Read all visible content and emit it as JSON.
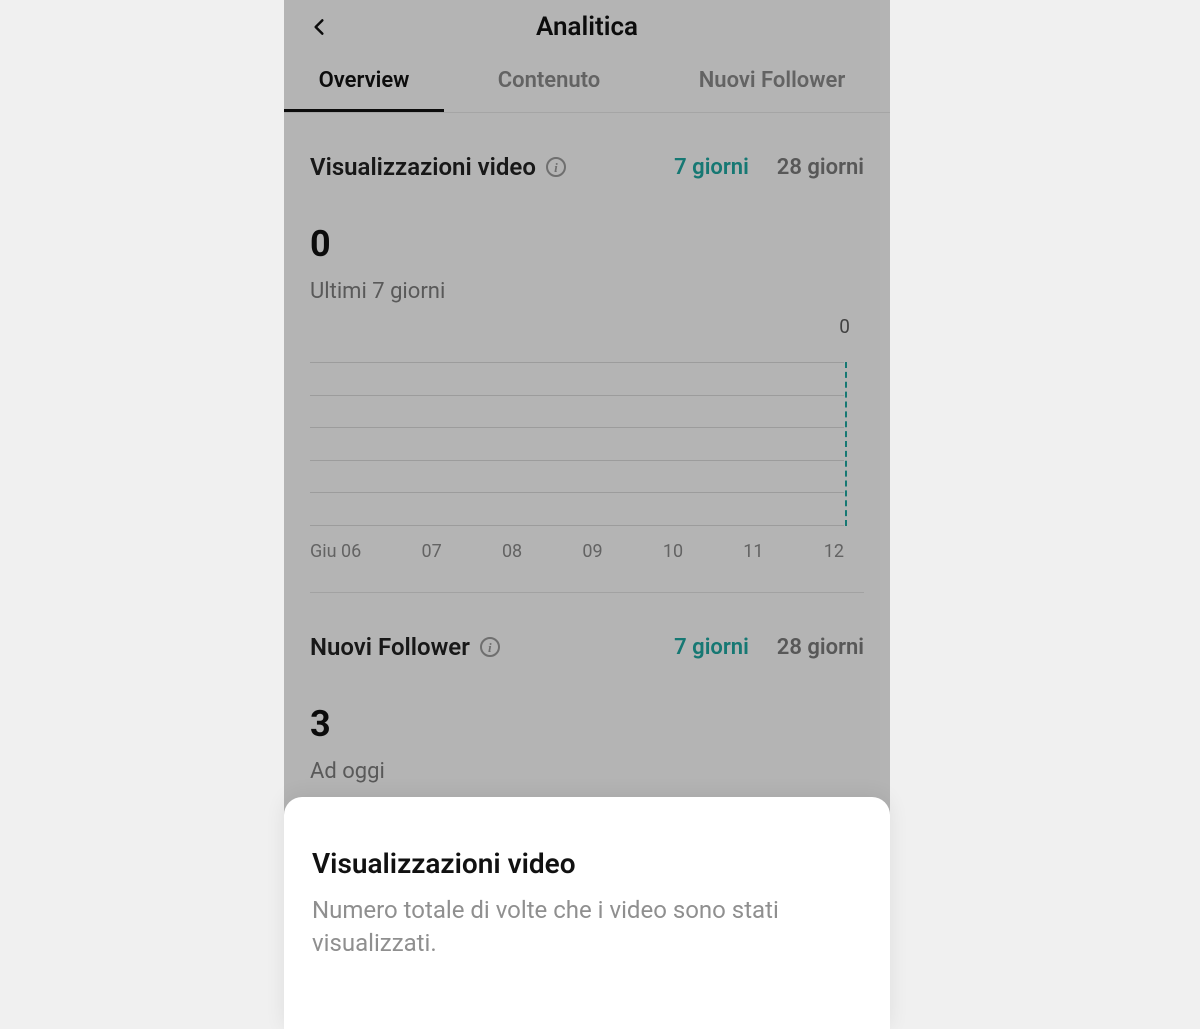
{
  "header": {
    "title": "Analitica"
  },
  "tabs": [
    {
      "label": "Overview",
      "active": true
    },
    {
      "label": "Contenuto",
      "active": false
    },
    {
      "label": "Nuovi Follower",
      "active": false
    }
  ],
  "video_views": {
    "title": "Visualizzazioni video",
    "range_7": "7 giorni",
    "range_28": "28 giorni",
    "active_range": "7",
    "value": "0",
    "sub": "Ultimi 7 giorni",
    "marker_label": "0",
    "marker_index": 6
  },
  "followers": {
    "title": "Nuovi Follower",
    "range_7": "7 giorni",
    "range_28": "28 giorni",
    "active_range": "7",
    "value": "3",
    "sub": "Ad oggi"
  },
  "sheet": {
    "title": "Visualizzazioni video",
    "body": "Numero totale di volte che i video sono stati visualizzati."
  },
  "chart_data": {
    "type": "bar",
    "categories": [
      "Giu 06",
      "07",
      "08",
      "09",
      "10",
      "11",
      "12"
    ],
    "values": [
      0,
      0,
      0,
      0,
      0,
      0,
      0
    ],
    "title": "Visualizzazioni video",
    "xlabel": "",
    "ylabel": "",
    "ylim": [
      0,
      6
    ]
  },
  "colors": {
    "accent": "#1fa7a0",
    "text_muted": "#8a8a8a"
  }
}
